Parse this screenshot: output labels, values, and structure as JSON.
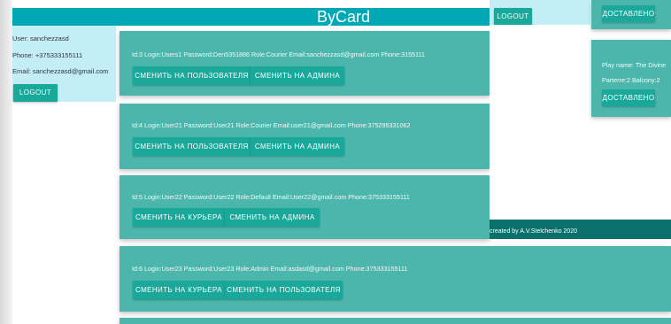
{
  "app_title": "ByCard",
  "user": {
    "name_line": "User: sanchezzasd",
    "phone_line": "Phone: +375333155111",
    "email_line": "Email: sanchezzasd@gmail.com",
    "logout_label": "LOGOUT"
  },
  "users": [
    {
      "info": "Id:3 Login:Users1 Password:Den5351886 Role:Courier Email:sanchezzasd@gmail.com Phone:3155111",
      "actions": [
        "СМЕНИТЬ НА ПОЛЬЗОВАТЕЛЯ",
        "СМЕНИТЬ НА АДМИНА"
      ]
    },
    {
      "info": "Id:4 Login:User21 Password:User21 Role:Courier Email:user21@gmail.com Phone:375295331062",
      "actions": [
        "СМЕНИТЬ НА ПОЛЬЗОВАТЕЛЯ",
        "СМЕНИТЬ НА АДМИНА"
      ]
    },
    {
      "info": "Id:5 Login:User22 Password:User22 Role:Default Email:User22@gmail.com Phone:375333155111",
      "actions": [
        "СМЕНИТЬ НА КУРЬЕРА",
        "СМЕНИТЬ НА АДМИНА"
      ]
    },
    {
      "info": "Id:6 Login:User23 Password:User23 Role:Admin Email:asdasd@gmail.com Phone:375333155111",
      "actions": [
        "СМЕНИТЬ НА КУРЬЕРА",
        "СМЕНИТЬ НА ПОЛЬЗОВАТЕЛЯ"
      ]
    }
  ],
  "overlay": {
    "logout_label": "LOGOUT",
    "delivered_label_1": "ДОСТАВЛЕНО",
    "play_name": "Play name: The Divine",
    "seats": "Parterre:2 Balcony:2",
    "delivered_label_2": "ДОСТАВЛЕНО",
    "footer": "created by A.V.Stelchenko 2020"
  },
  "colors": {
    "header": "#00a8b5",
    "card": "#4db6ac",
    "button": "#1aa89a",
    "panel": "#c4eef5",
    "footer": "#0b6f6b"
  }
}
